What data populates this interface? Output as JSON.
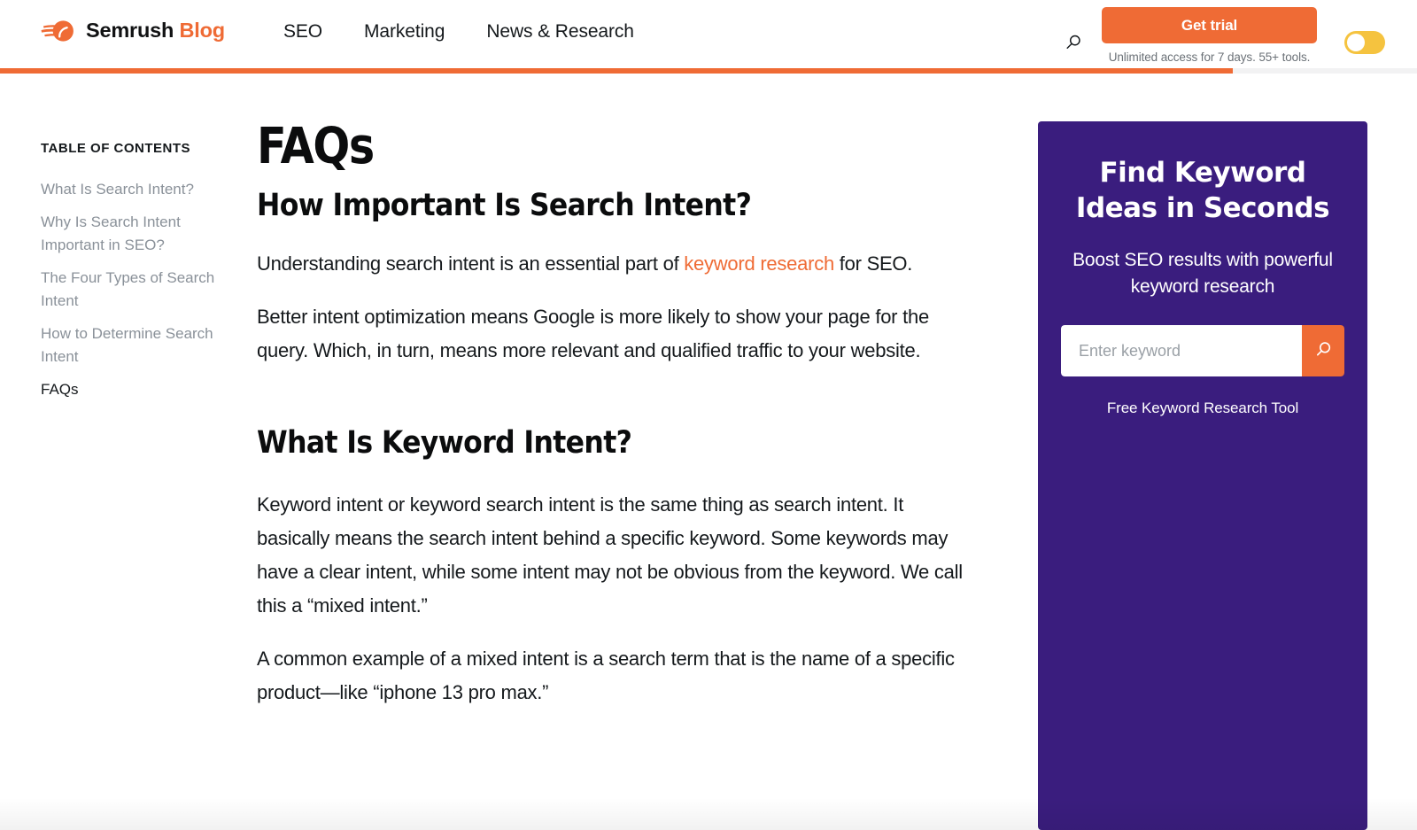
{
  "header": {
    "brand": {
      "logo_icon": "semrush-comet-icon",
      "name": "Semrush",
      "section": "Blog"
    },
    "nav_items": [
      {
        "label": "SEO"
      },
      {
        "label": "Marketing"
      },
      {
        "label": "News & Research"
      }
    ],
    "search_icon": "search-icon",
    "trial": {
      "label": "Get trial",
      "caption": "Unlimited access for 7 days. 55+ tools."
    },
    "theme_toggle": {
      "state": "off",
      "color": "#f5c33f"
    },
    "reading_progress": {
      "percent": 87,
      "fill_color": "#ef6b35",
      "track_color": "#f2f2f3"
    }
  },
  "toc": {
    "title": "TABLE OF CONTENTS",
    "items": [
      {
        "label": "What Is Search Intent?",
        "active": false
      },
      {
        "label": "Why Is Search Intent Important in SEO?",
        "active": false
      },
      {
        "label": "The Four Types of Search Intent",
        "active": false
      },
      {
        "label": "How to Determine Search Intent",
        "active": false
      },
      {
        "label": "FAQs",
        "active": true
      }
    ]
  },
  "article": {
    "title": "FAQs",
    "sections": [
      {
        "heading": "How Important Is Search Intent?",
        "paragraphs": [
          {
            "before": "Understanding search intent is an essential part of ",
            "link": "keyword research",
            "after": " for SEO."
          },
          {
            "text": "Better intent optimization means Google is more likely to show your page for the query. Which, in turn, means more relevant and qualified traffic to your website."
          }
        ]
      },
      {
        "heading": "What Is Keyword Intent?",
        "paragraphs": [
          {
            "text": "Keyword intent or keyword search intent is the same thing as search intent. It basically means the search intent behind a specific keyword. Some keywords may have a clear intent, while some intent may not be obvious from the keyword. We call this a “mixed intent.”"
          },
          {
            "text": "A common example of a mixed intent is a search term that is the name of a specific product—like “iphone 13 pro max.”"
          }
        ]
      }
    ]
  },
  "promo": {
    "title": "Find Keyword Ideas in Seconds",
    "subtitle": "Boost SEO results with powerful keyword research",
    "input_placeholder": "Enter keyword",
    "input_value": "",
    "submit_icon": "search-icon",
    "footer_link": "Free Keyword Research Tool",
    "background_color": "#3a1d7e",
    "accent_color": "#ef6b35"
  }
}
